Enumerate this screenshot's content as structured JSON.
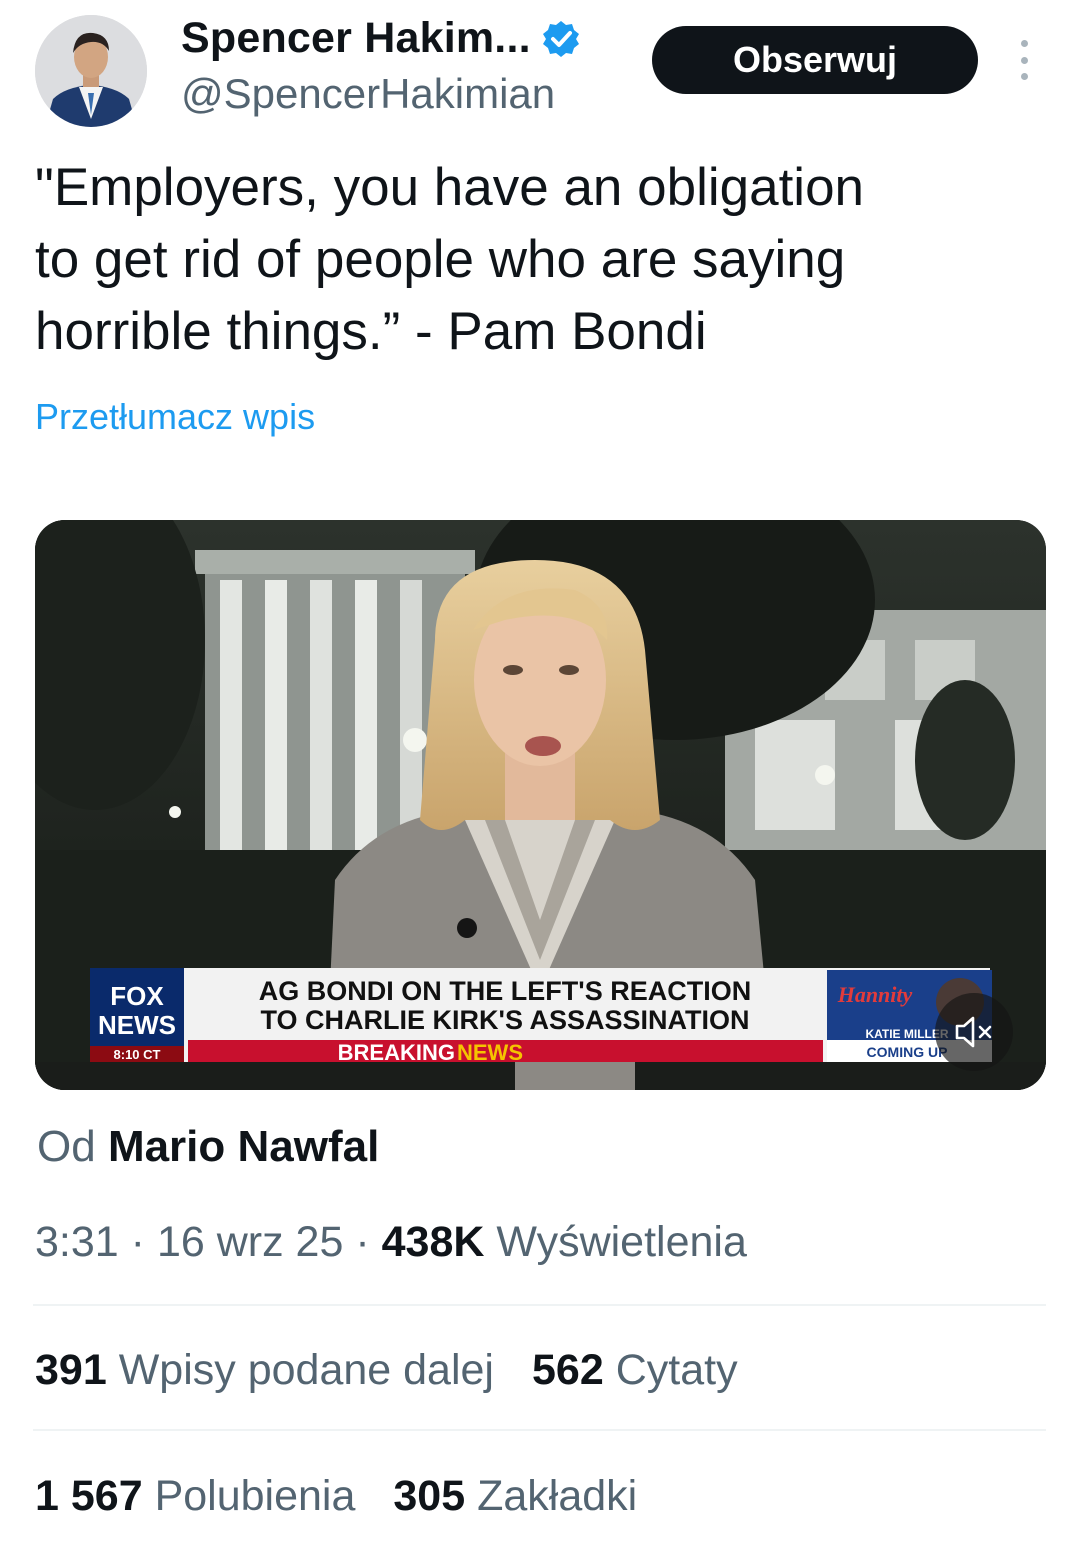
{
  "author": {
    "display_name": "Spencer Hakim...",
    "handle": "@SpencerHakimian",
    "verified_icon": "verified-badge-icon"
  },
  "actions": {
    "follow_label": "Obserwuj",
    "more_icon": "more-vertical-icon"
  },
  "tweet": {
    "text_lines": [
      "\"Employers, you have an obligation",
      "to get rid of people who are saying",
      "horrible things.” - Pam Bondi"
    ],
    "translate_label": "Przetłumacz wpis"
  },
  "media": {
    "chyron_line1": "AG BONDI ON THE LEFT'S REACTION",
    "chyron_line2": "TO CHARLIE KIRK'S ASSASSINATION",
    "breaking_1": "BREAKING ",
    "breaking_2": "NEWS",
    "network_1": "FOX",
    "network_2": "NEWS",
    "time_bug": "8:10 CT",
    "promo_show": "Hannity",
    "promo_guest": "KATIE MILLER",
    "promo_next": "COMING UP",
    "mute_icon": "volume-muted-icon"
  },
  "attribution": {
    "prefix": "Od",
    "source_name": "Mario Nawfal"
  },
  "meta": {
    "time": "3:31",
    "date": "16 wrz 25",
    "views_count": "438K",
    "views_label": "Wyświetlenia"
  },
  "stats": {
    "reposts_count": "391",
    "reposts_label": "Wpisy podane dalej",
    "quotes_count": "562",
    "quotes_label": "Cytaty",
    "likes_count": "1 567",
    "likes_label": "Polubienia",
    "bookmarks_count": "305",
    "bookmarks_label": "Zakładki"
  },
  "colors": {
    "text_primary": "#0f1419",
    "text_secondary": "#536471",
    "link": "#1d9bf0",
    "follow_bg": "#0f1419",
    "divider": "#eff3f4",
    "breaking_red": "#c8102e"
  }
}
